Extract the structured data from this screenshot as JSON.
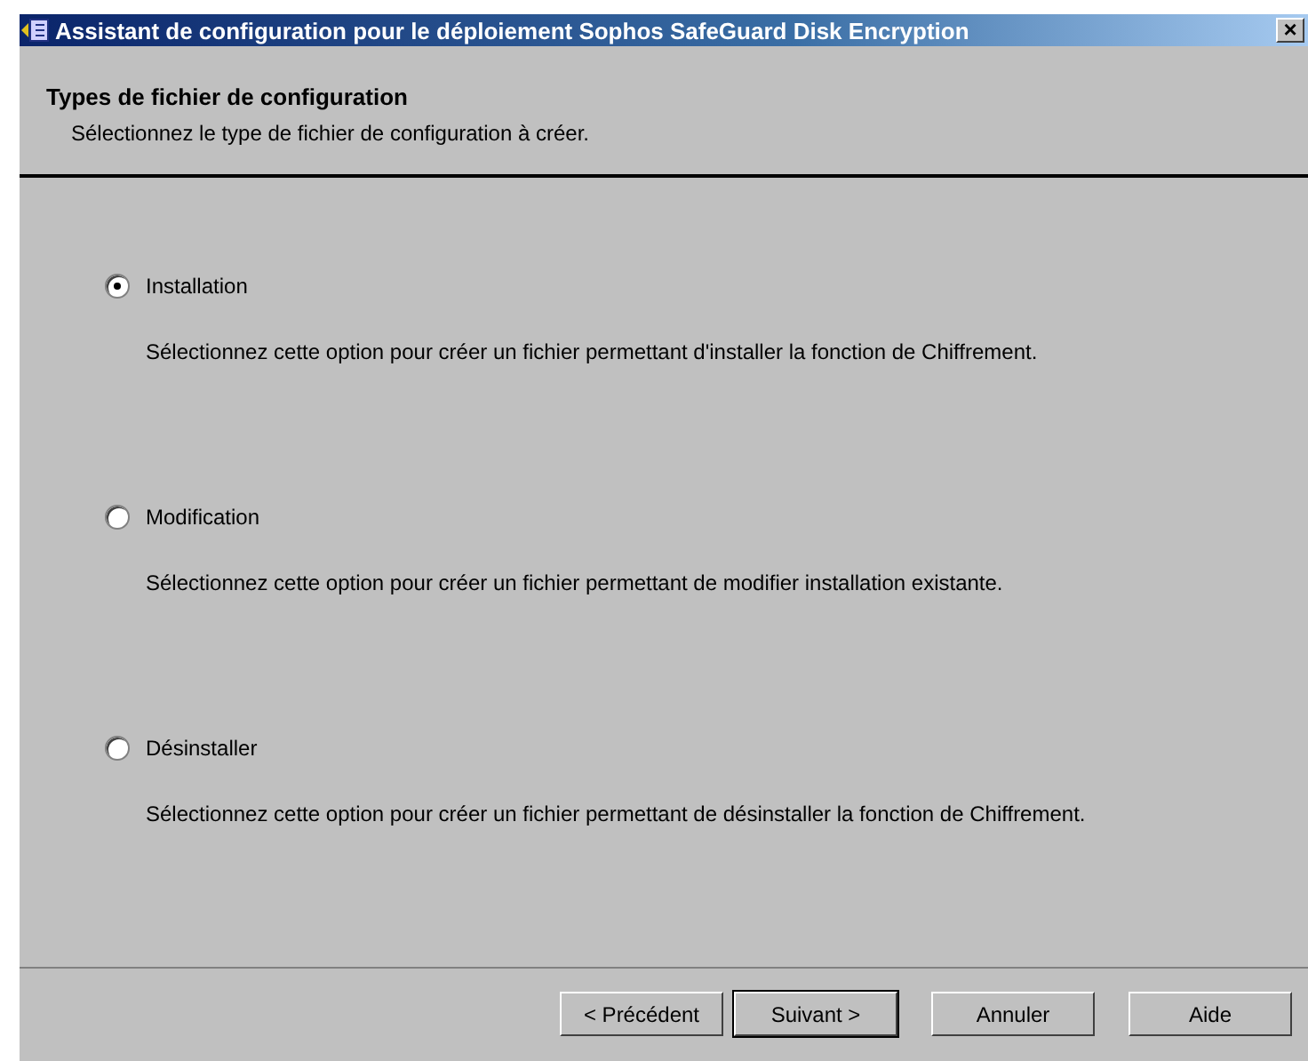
{
  "window": {
    "title": "Assistant de configuration pour le déploiement Sophos SafeGuard Disk Encryption",
    "close": "×"
  },
  "header": {
    "title": "Types de fichier de configuration",
    "subtitle": "Sélectionnez le type de fichier de configuration à créer."
  },
  "options": [
    {
      "label": "Installation",
      "selected": true,
      "description": "Sélectionnez cette option pour créer un fichier permettant d'installer la fonction de Chiffrement."
    },
    {
      "label": "Modification",
      "selected": false,
      "description": "Sélectionnez cette option pour créer un fichier permettant de modifier installation existante."
    },
    {
      "label": "Désinstaller",
      "selected": false,
      "description": "Sélectionnez cette option pour créer un fichier permettant de désinstaller la fonction de Chiffrement."
    }
  ],
  "buttons": [
    {
      "label": "< Précédent",
      "default": false
    },
    {
      "label": "Suivant >",
      "default": true
    },
    {
      "label": "Annuler",
      "default": false
    },
    {
      "label": "Aide",
      "default": false
    }
  ]
}
